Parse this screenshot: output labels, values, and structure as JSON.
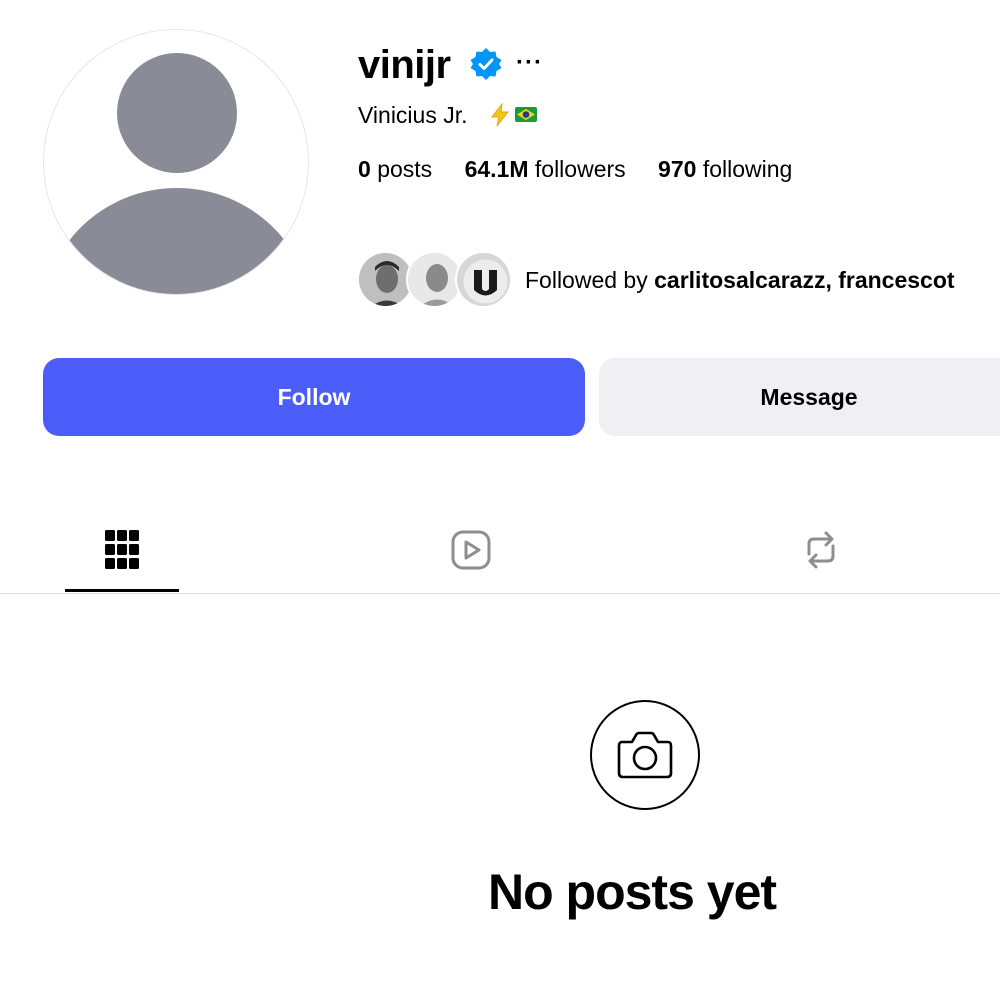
{
  "profile": {
    "username": "vinijr",
    "more_label": "···",
    "full_name": "Vinicius Jr.",
    "bio_emoji": "⚡",
    "stats": [
      {
        "value": "0",
        "label": "posts"
      },
      {
        "value": "64.1M",
        "label": "followers"
      },
      {
        "value": "970",
        "label": "following"
      }
    ],
    "followed_by": {
      "prefix": "Followed by ",
      "names": "carlitosalcarazz, francescot"
    }
  },
  "actions": {
    "follow_label": "Follow",
    "message_label": "Message"
  },
  "tabs": [
    {
      "icon": "grid-icon",
      "active": true
    },
    {
      "icon": "reels-icon",
      "active": false
    },
    {
      "icon": "reposts-icon",
      "active": false
    }
  ],
  "empty_state": {
    "icon": "camera-icon",
    "text": "No posts yet"
  },
  "colors": {
    "follow_button": "#4a5df9",
    "message_button": "#efeff4",
    "verified_badge": "#0095f6",
    "avatar_placeholder": "#898c97"
  }
}
